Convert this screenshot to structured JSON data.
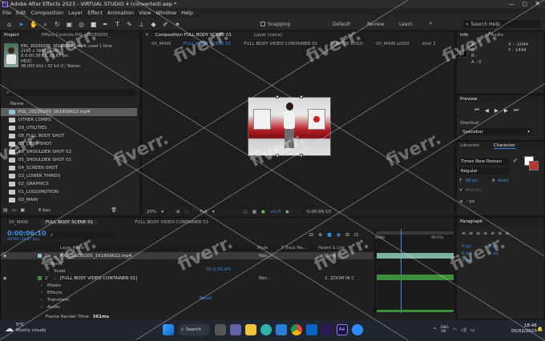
{
  "window": {
    "title": "Adobe After Effects 2023 - VIRTUAL STUDIO 4 (converted).aep *"
  },
  "menu": [
    "File",
    "Edit",
    "Composition",
    "Layer",
    "Effect",
    "Animation",
    "View",
    "Window",
    "Help"
  ],
  "toolbar": {
    "snapping": "Snapping",
    "workspaces": [
      "Default",
      "Review",
      "Learn"
    ],
    "search_placeholder": "Search Help"
  },
  "project": {
    "tab_project": "Project",
    "tab_effect_controls": "Effect Controls PXL_20230205_",
    "selected": {
      "name": "PXL_20230205_161959622.mp4",
      "used": ", used 1 time",
      "res": "2160 x 3840 (1.00)",
      "dur": "Δ 0:00:38:13, 29.87 fps",
      "codec": "HEVC",
      "audio": "48.000 kHz / 32 bit U / Stereo"
    },
    "col_name": "Name",
    "items": [
      "PXL_20230205_161959622.mp4",
      "OTHER COMPS",
      "09_UTILITIES",
      "08_FULL BODY SHOT",
      "07_DESK SHOT",
      "06_SHOULDER SHOT 02",
      "05_SHOULDER SHOT 01",
      "04_SCREEN SHOT",
      "03_LOWER THIRDS",
      "02_GRAPHICS",
      "01_LOGO/MOTION",
      "00_MAIN"
    ],
    "bpc": "8 bpc"
  },
  "comp": {
    "tab_label": "Composition FULL BODY SCENE 01",
    "layer_tab": "Layer (none)",
    "subtabs": [
      "00_MAIN",
      "FULL BODY SCENE 01",
      "FULL BODY VIDEO CONTAINER 01",
      "BUMPER LOGO",
      "00_MAIN LOGO",
      "shot 2"
    ],
    "zoom": "25%",
    "resolution": "Full",
    "timecode_footer": "0:00:06:10",
    "exposure": "+0.0"
  },
  "info": {
    "tab": "Info",
    "tab_audio": "Audio",
    "r": "R :",
    "g": "G :",
    "b": "B :",
    "a": "A : 0",
    "x": "X : -2044",
    "y": "Y : 1444"
  },
  "preview": {
    "tab": "Preview",
    "shortcut_label": "Shortcut",
    "shortcut_value": "Spacebar"
  },
  "character": {
    "tab_libraries": "Libraries",
    "tab_character": "Character",
    "font": "Times New Roman",
    "style": "Regular",
    "size": "36 px",
    "leading": "Auto",
    "tracking": "Metrics",
    "units": "- px"
  },
  "paragraph": {
    "tab": "Paragraph",
    "values": [
      "0 px",
      "0 px",
      "0 px",
      "0 px",
      "0 px"
    ]
  },
  "timeline": {
    "tabs": [
      "00_MAIN",
      "FULL BODY SCENE 01",
      "FULL BODY VIDEO CONTAINER 01"
    ],
    "timecode": "0:00:06:10",
    "fps": "00190 (29.87 fps)",
    "cols": {
      "layer_name": "Layer Name",
      "mode": "Mode",
      "trackmat": "T Track Ma...",
      "parent": "Parent & Link"
    },
    "layers": [
      {
        "num": "1",
        "name": "PXL_20230205_161959622.mp4",
        "mode": "Nor...",
        "parent": "None"
      },
      {
        "num": "",
        "name": "Effects",
        "mode": "",
        "parent": ""
      },
      {
        "num": "",
        "name": "Scale",
        "mode": "",
        "parent": ""
      },
      {
        "num": "2",
        "name": "[FULL BODY VIDEO CONTAINER 01]",
        "mode": "Nor...",
        "parent": "2. ZOOM IN C"
      },
      {
        "num": "",
        "name": "Masks",
        "mode": "",
        "parent": ""
      },
      {
        "num": "",
        "name": "Effects",
        "mode": "",
        "parent": ""
      },
      {
        "num": "",
        "name": "Transform",
        "mode": "",
        "parent": ""
      },
      {
        "num": "",
        "name": "Audio",
        "mode": "",
        "parent": ""
      }
    ],
    "scale_value": "30.0,30.0%",
    "reset": "Reset",
    "ruler": [
      "0:00s",
      "00:15s"
    ],
    "render_label": "Frame Render Time:",
    "render_value": "361ms"
  },
  "taskbar": {
    "temp": "5°C",
    "weather": "Mostly cloudy",
    "search": "Search",
    "lang": "ENG",
    "region": "UK",
    "time": "18:46",
    "date": "05/02/2023"
  },
  "watermark": "fiverr."
}
